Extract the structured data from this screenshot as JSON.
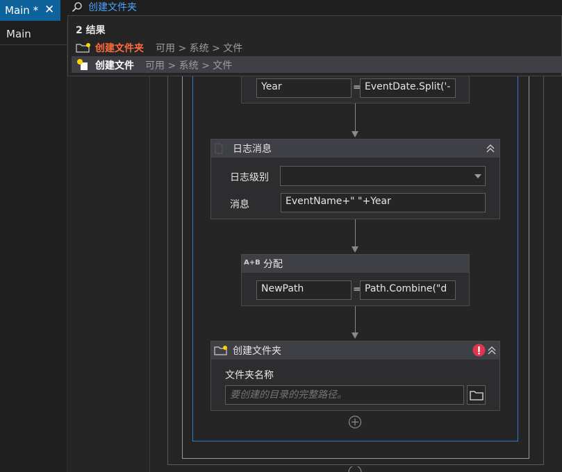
{
  "tab": {
    "label": "Main *",
    "close": "✕"
  },
  "left_panel": {
    "title": "Main"
  },
  "search": {
    "query": "创建文件夹"
  },
  "results": {
    "count": "2 结果",
    "items": [
      {
        "name": "创建文件夹",
        "path": "可用 > 系统 > 文件",
        "highlight_color": "#ff6a3d"
      },
      {
        "name": "创建文件",
        "path": "可用 > 系统 > 文件",
        "highlight_color": "#ffffff"
      }
    ]
  },
  "assign1": {
    "to": "Year",
    "eq": "=",
    "value": "EventDate.Split('-"
  },
  "log": {
    "title": "日志消息",
    "level_label": "日志级别",
    "level_value": "",
    "message_label": "消息",
    "message_value": "EventName+\" \"+Year"
  },
  "assign2": {
    "title": "分配",
    "icon_text": "A+B",
    "to": "NewPath",
    "eq": "=",
    "value": "Path.Combine(\"d"
  },
  "create_folder": {
    "title": "创建文件夹",
    "folder_label": "文件夹名称",
    "folder_placeholder": "要创建的目录的完整路径。"
  },
  "colors": {
    "accent": "#0e639c",
    "sequence_border": "#2f7cd6",
    "error": "#e0354f",
    "query": "#4aa3ff"
  }
}
